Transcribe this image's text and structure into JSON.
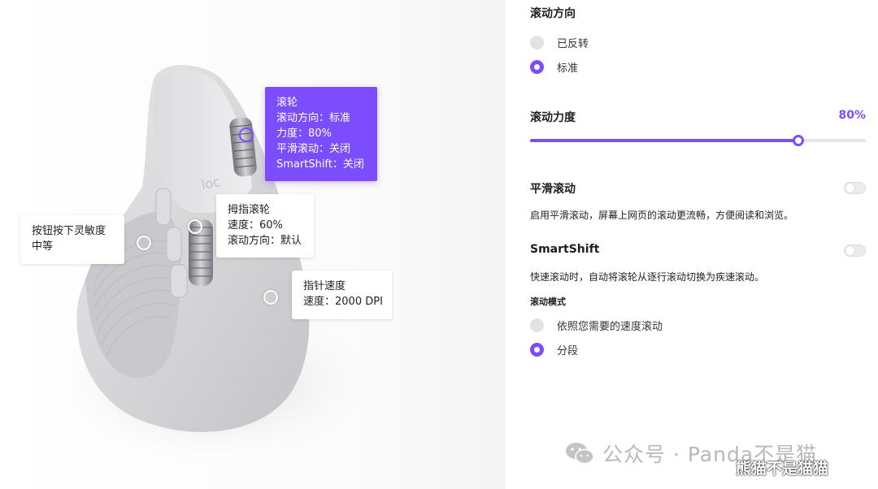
{
  "callouts": {
    "scroll_wheel": {
      "title": "滚轮",
      "lines": [
        "滚动方向：标准",
        "力度：80%",
        "平滑滚动：关闭",
        "SmartShift：关闭"
      ]
    },
    "thumb_wheel": {
      "title": "拇指滚轮",
      "lines": [
        "速度：60%",
        "滚动方向：默认"
      ]
    },
    "button_sensitivity": {
      "title": "按钮按下灵敏度",
      "lines": [
        "中等"
      ]
    },
    "pointer_speed": {
      "title": "指针速度",
      "lines": [
        "速度：2000 DPI"
      ]
    }
  },
  "settings": {
    "scroll_direction": {
      "title": "滚动方向",
      "options": [
        {
          "label": "已反转",
          "selected": false
        },
        {
          "label": "标准",
          "selected": true
        }
      ]
    },
    "scroll_force": {
      "title": "滚动力度",
      "value_label": "80%",
      "value": 0.8
    },
    "smooth_scroll": {
      "title": "平滑滚动",
      "enabled": false,
      "description": "启用平滑滚动，屏幕上网页的滚动更流畅，方便阅读和浏览。"
    },
    "smartshift": {
      "title": "SmartShift",
      "enabled": false,
      "description": "快速滚动时，自动将滚轮从逐行滚动切换为疾速滚动。",
      "mode_title": "滚动模式",
      "options": [
        {
          "label": "依照您需要的速度滚动",
          "selected": false
        },
        {
          "label": "分段",
          "selected": true
        }
      ]
    }
  },
  "watermark": {
    "text": "公众号 · Panda不是猫",
    "overlay": "熊猫不是猫猫"
  },
  "colors": {
    "accent": "#7c4dfc",
    "radio_off": "#e2e2e4",
    "track": "#e6e6e8"
  },
  "icons": {
    "wechat": "wechat-icon"
  }
}
